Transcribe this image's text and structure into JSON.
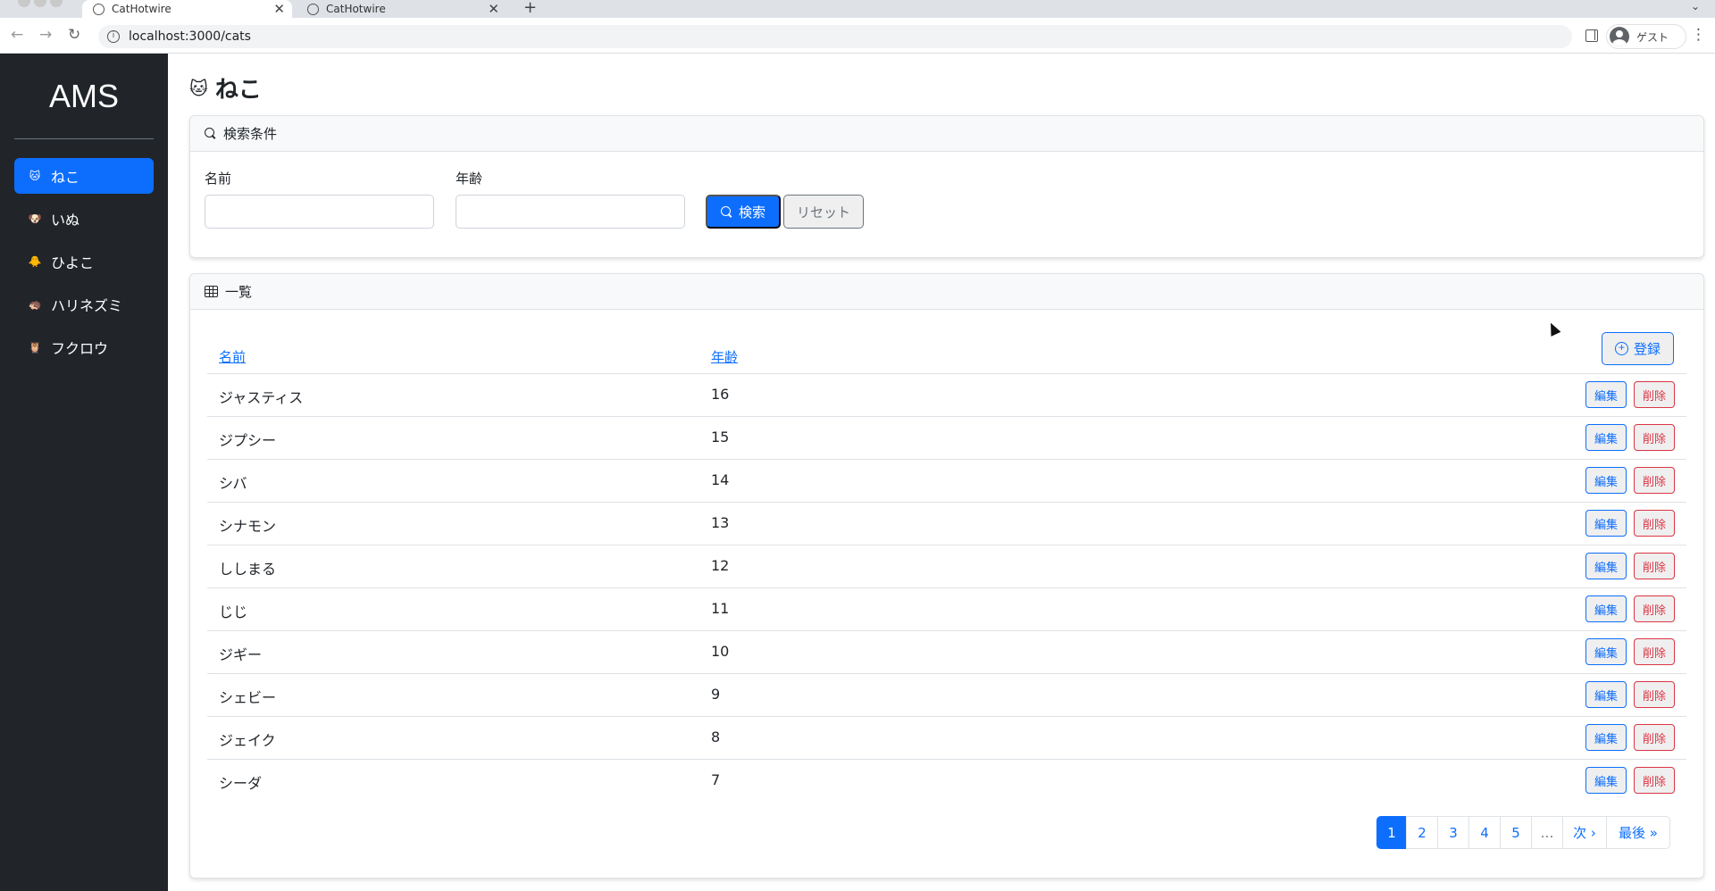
{
  "browser": {
    "tabs": [
      {
        "title": "CatHotwire",
        "active": true
      },
      {
        "title": "CatHotwire",
        "active": false
      }
    ],
    "url": "localhost:3000/cats",
    "profile_label": "ゲスト"
  },
  "sidebar": {
    "brand": "AMS",
    "items": [
      {
        "emoji": "🐱",
        "label": "ねこ",
        "active": true
      },
      {
        "emoji": "🐶",
        "label": "いぬ",
        "active": false
      },
      {
        "emoji": "🐥",
        "label": "ひよこ",
        "active": false
      },
      {
        "emoji": "🦔",
        "label": "ハリネズミ",
        "active": false
      },
      {
        "emoji": "🦉",
        "label": "フクロウ",
        "active": false
      }
    ]
  },
  "page": {
    "emoji": "🐱",
    "title": "ねこ"
  },
  "search": {
    "header": "検索条件",
    "name_label": "名前",
    "name_value": "",
    "age_label": "年齢",
    "age_value": "",
    "search_button": "検索",
    "reset_button": "リセット"
  },
  "list": {
    "header": "一覧",
    "columns": [
      "名前",
      "年齢"
    ],
    "register_button": "登録",
    "edit_label": "編集",
    "delete_label": "削除",
    "rows": [
      {
        "name": "ジャスティス",
        "age": "16"
      },
      {
        "name": "ジプシー",
        "age": "15"
      },
      {
        "name": "シバ",
        "age": "14"
      },
      {
        "name": "シナモン",
        "age": "13"
      },
      {
        "name": "ししまる",
        "age": "12"
      },
      {
        "name": "じじ",
        "age": "11"
      },
      {
        "name": "ジギー",
        "age": "10"
      },
      {
        "name": "シェビー",
        "age": "9"
      },
      {
        "name": "ジェイク",
        "age": "8"
      },
      {
        "name": "シーダ",
        "age": "7"
      }
    ]
  },
  "pagination": {
    "pages": [
      "1",
      "2",
      "3",
      "4",
      "5"
    ],
    "current": "1",
    "gap": "…",
    "next": "次 ›",
    "last": "最後 »"
  },
  "colors": {
    "primary": "#0d6efd",
    "danger": "#dc3545",
    "sidebar_bg": "#212529"
  }
}
